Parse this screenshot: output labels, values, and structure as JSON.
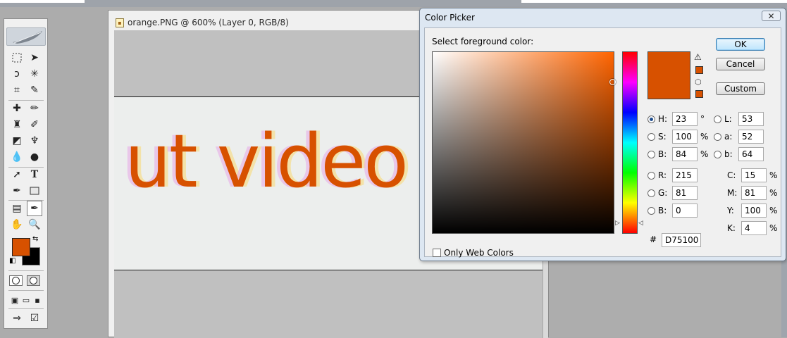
{
  "document": {
    "title": "orange.PNG @ 600% (Layer 0, RGB/8)",
    "canvas_text": "ut video"
  },
  "toolbox": {
    "foreground_color": "#d75100",
    "background_color": "#000000"
  },
  "color_picker": {
    "title": "Color Picker",
    "close_label": "✕",
    "prompt": "Select foreground color:",
    "buttons": {
      "ok": "OK",
      "cancel": "Cancel",
      "custom": "Custom"
    },
    "selected_color": "#D75100",
    "hsb": [
      {
        "label": "H:",
        "value": "23",
        "unit": "°",
        "selected": true
      },
      {
        "label": "S:",
        "value": "100",
        "unit": "%",
        "selected": false
      },
      {
        "label": "B:",
        "value": "84",
        "unit": "%",
        "selected": false
      }
    ],
    "rgb": [
      {
        "label": "R:",
        "value": "215"
      },
      {
        "label": "G:",
        "value": "81"
      },
      {
        "label": "B:",
        "value": "0"
      }
    ],
    "lab": [
      {
        "label": "L:",
        "value": "53"
      },
      {
        "label": "a:",
        "value": "52"
      },
      {
        "label": "b:",
        "value": "64"
      }
    ],
    "cmyk": [
      {
        "label": "C:",
        "value": "15",
        "unit": "%"
      },
      {
        "label": "M:",
        "value": "81",
        "unit": "%"
      },
      {
        "label": "Y:",
        "value": "100",
        "unit": "%"
      },
      {
        "label": "K:",
        "value": "4",
        "unit": "%"
      }
    ],
    "hex_label": "#",
    "hex_value": "D75100",
    "only_web_colors": "Only Web Colors"
  }
}
